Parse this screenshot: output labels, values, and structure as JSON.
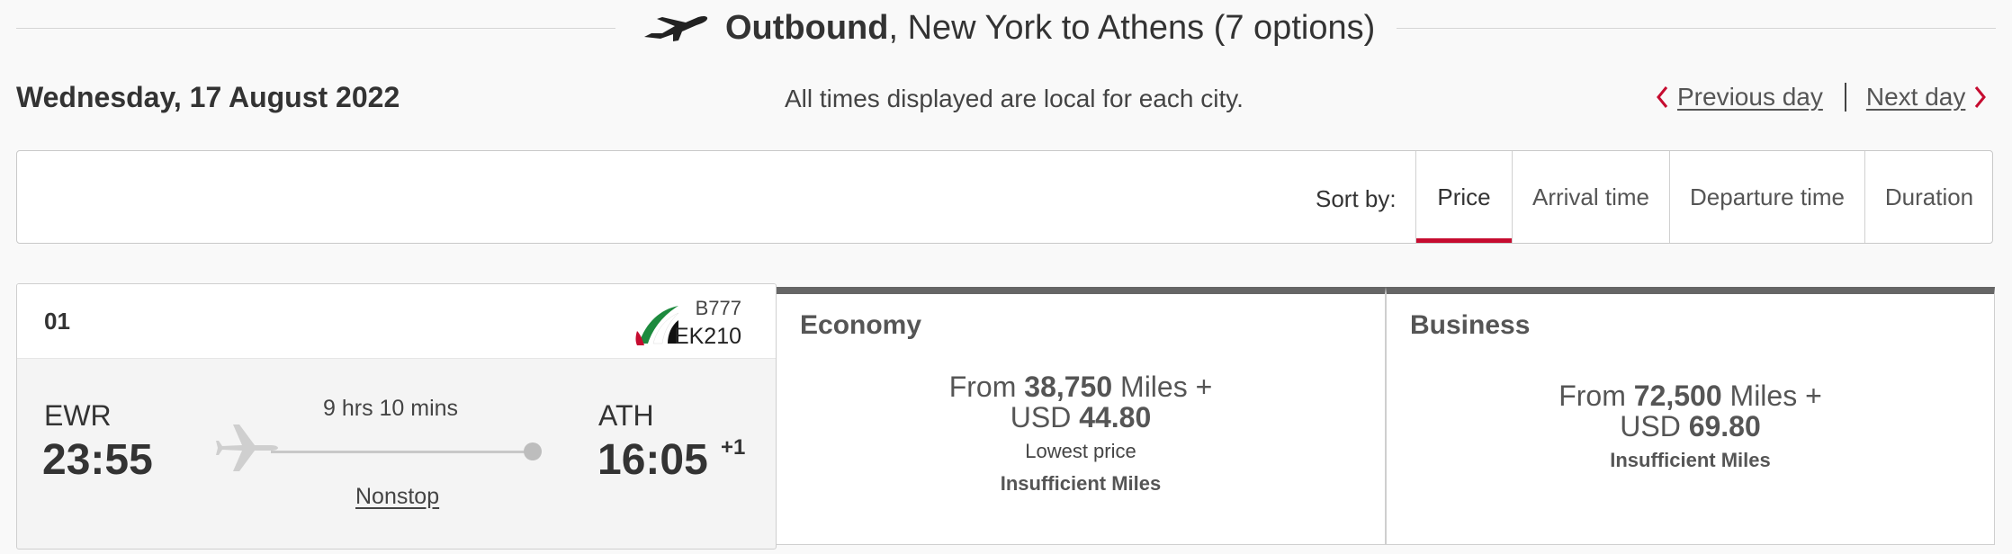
{
  "header": {
    "direction": "Outbound",
    "route": ", New York to Athens (7 options)",
    "plane_icon": "plane-departure-icon"
  },
  "date": "Wednesday, 17 August 2022",
  "timezone_note": "All times displayed are local for each city.",
  "day_nav": {
    "previous": "Previous day",
    "next": "Next day"
  },
  "sort": {
    "label": "Sort by:",
    "options": [
      "Price",
      "Arrival time",
      "Departure time",
      "Duration"
    ],
    "active": "Price",
    "accent_color": "#c60c30"
  },
  "flight": {
    "option_number": "01",
    "aircraft": "B777",
    "flight_number": "EK210",
    "origin_code": "EWR",
    "departure_time": "23:55",
    "destination_code": "ATH",
    "arrival_time": "16:05",
    "day_offset": "+1",
    "duration": "9 hrs 10 mins",
    "stops": "Nonstop"
  },
  "fares": {
    "economy": {
      "title": "Economy",
      "prefix": "From ",
      "miles": "38,750",
      "miles_suffix": " Miles +",
      "currency": "USD ",
      "amount": "44.80",
      "tag": "Lowest price",
      "status": "Insufficient Miles"
    },
    "business": {
      "title": "Business",
      "prefix": "From ",
      "miles": "72,500",
      "miles_suffix": " Miles +",
      "currency": "USD ",
      "amount": "69.80",
      "status": "Insufficient Miles"
    }
  }
}
